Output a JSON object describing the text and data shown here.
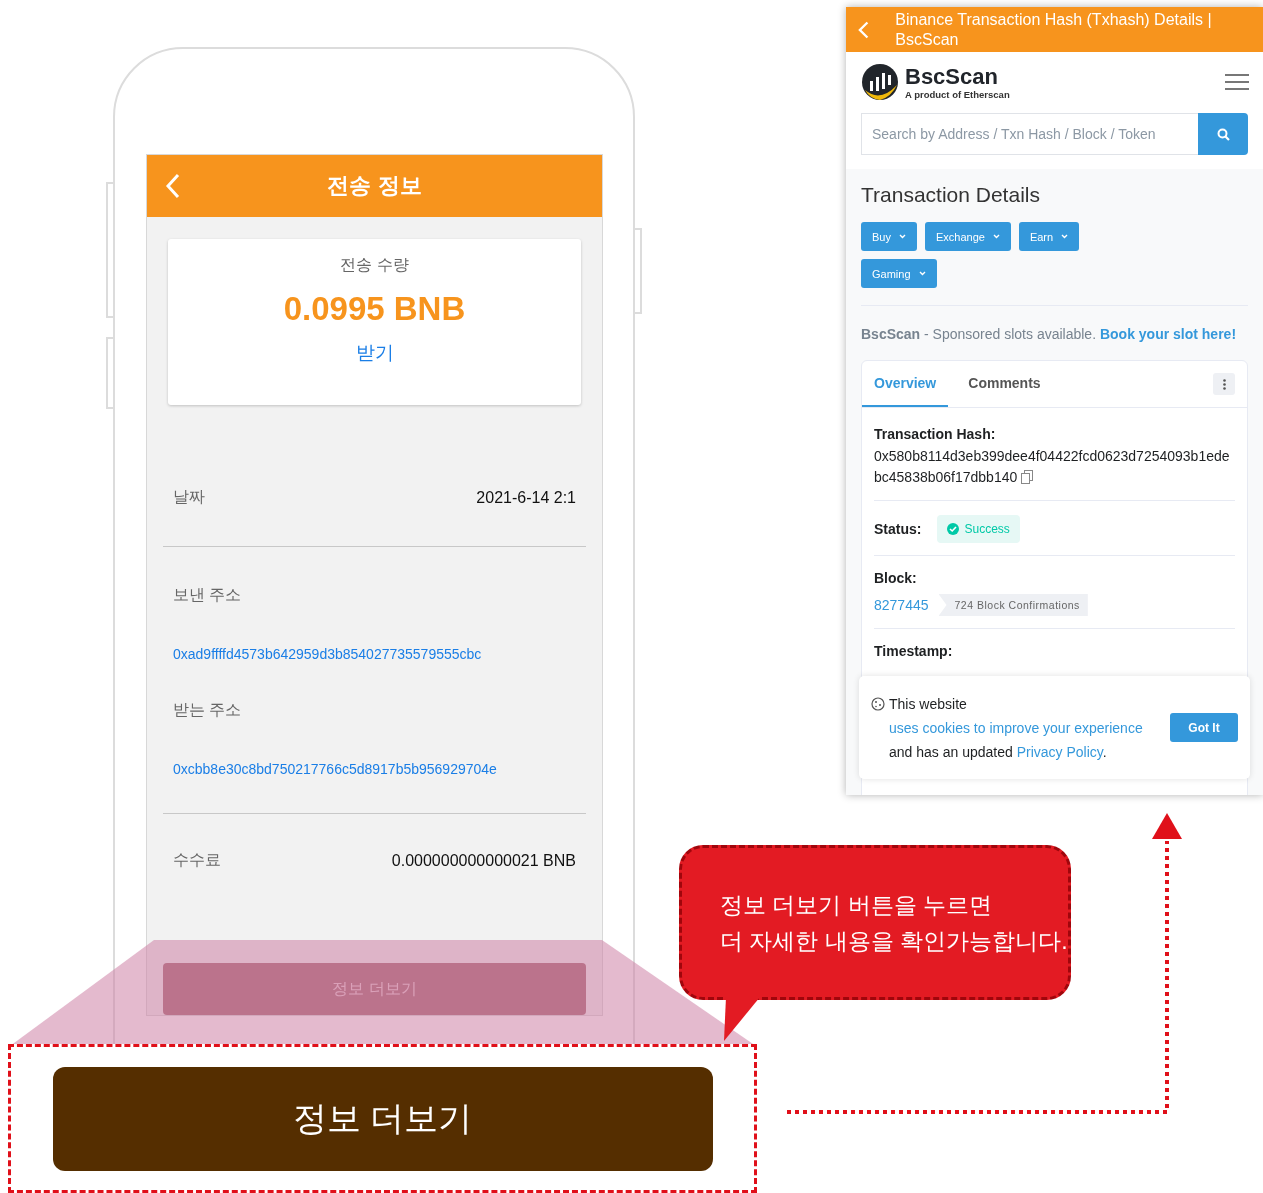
{
  "phone": {
    "header": {
      "title": "전송 정보"
    },
    "amount_card": {
      "label": "전송 수량",
      "amount": "0.0995 BNB",
      "direction": "받기"
    },
    "sections": [
      [
        {
          "kind": "inline",
          "label": "날짜",
          "value": "2021-6-14 2:1"
        }
      ],
      [
        {
          "kind": "stacked",
          "label": "보낸 주소",
          "value": "0xad9ffffd4573b642959d3b854027735579555cbc"
        },
        {
          "kind": "stacked",
          "label": "받는 주소",
          "value": "0xcbb8e30c8bd750217766c5d8917b5b956929704e"
        }
      ],
      [
        {
          "kind": "inline",
          "label": "수수료",
          "value": "0.000000000000021 BNB"
        }
      ]
    ],
    "more_button": "정보 더보기"
  },
  "zoomed_button": "정보 더보기",
  "callout": {
    "lines": [
      "정보 더보기 버튼을 누르면",
      "더 자세한 내용을 확인가능합니다."
    ]
  },
  "browser": {
    "title": "Binance Transaction Hash (Txhash) Details | BscScan",
    "logo": {
      "name": "BscScan",
      "tagline": "A product of Etherscan"
    },
    "search": {
      "placeholder": "Search by Address / Txn Hash / Block / Token"
    },
    "heading": "Transaction Details",
    "menu_buttons": [
      "Buy",
      "Exchange",
      "Earn",
      "Gaming"
    ],
    "sponsor": {
      "text": "**BscScan** - Sponsored slots available.",
      "link": "Book your slot here!"
    },
    "tabs": [
      {
        "label": "Overview",
        "selected": true
      },
      {
        "label": "Comments",
        "selected": false
      }
    ],
    "fields": [
      {
        "kind": "hash",
        "label": "Transaction Hash:",
        "value": "0x580b8114d3eb399dee4f04422fcd0623d7254093b1edebc45838b06f17dbb140"
      },
      {
        "kind": "status",
        "label": "Status:",
        "value": "Success"
      },
      {
        "kind": "block",
        "label": "Block:",
        "value": "8277445",
        "badge": "724 Block Confirmations"
      },
      {
        "kind": "plain",
        "label": "Timestamp:"
      }
    ],
    "cookie": {
      "parts": [
        {
          "kind": "text",
          "text": "This website"
        },
        {
          "kind": "link",
          "text": "uses cookies to improve your experience"
        },
        {
          "kind": "text",
          "text": "and has an updated"
        },
        {
          "kind": "link",
          "text": "Privacy Policy"
        },
        {
          "kind": "text",
          "text": "."
        }
      ],
      "button": "Got It"
    }
  }
}
